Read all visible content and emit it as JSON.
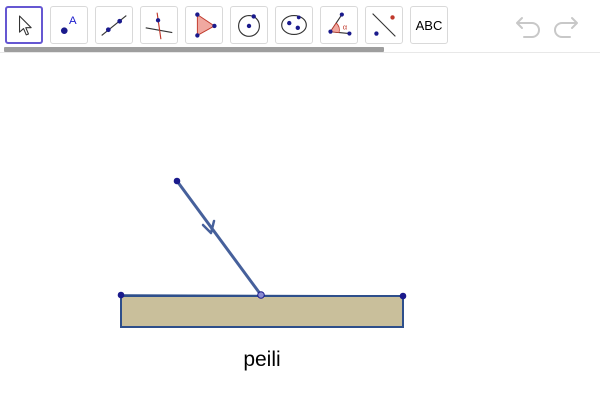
{
  "toolbar": {
    "tools": [
      {
        "id": "move",
        "icon": "move-pointer-icon",
        "active": true
      },
      {
        "id": "point",
        "icon": "point-icon",
        "label": "A"
      },
      {
        "id": "line",
        "icon": "line-through-two-points-icon"
      },
      {
        "id": "perpendicular",
        "icon": "perpendicular-line-icon"
      },
      {
        "id": "polygon",
        "icon": "polygon-icon"
      },
      {
        "id": "circle",
        "icon": "circle-center-point-icon"
      },
      {
        "id": "ellipse",
        "icon": "ellipse-icon"
      },
      {
        "id": "angle",
        "icon": "angle-icon",
        "label": "α"
      },
      {
        "id": "reflect",
        "icon": "reflect-about-line-icon"
      },
      {
        "id": "text",
        "icon": "text-tool-icon",
        "label": "ABC"
      }
    ],
    "undo_icon": "undo-icon",
    "redo_icon": "redo-icon",
    "undo_color": "#c8c8c8"
  },
  "colors": {
    "accent": "#6557d2",
    "point": "#1a1a8c",
    "ray": "#46609b",
    "mirror_fill": "#c9bf9b",
    "mirror_stroke": "#2e4f8b"
  },
  "canvas": {
    "mirror_label": "peili"
  }
}
